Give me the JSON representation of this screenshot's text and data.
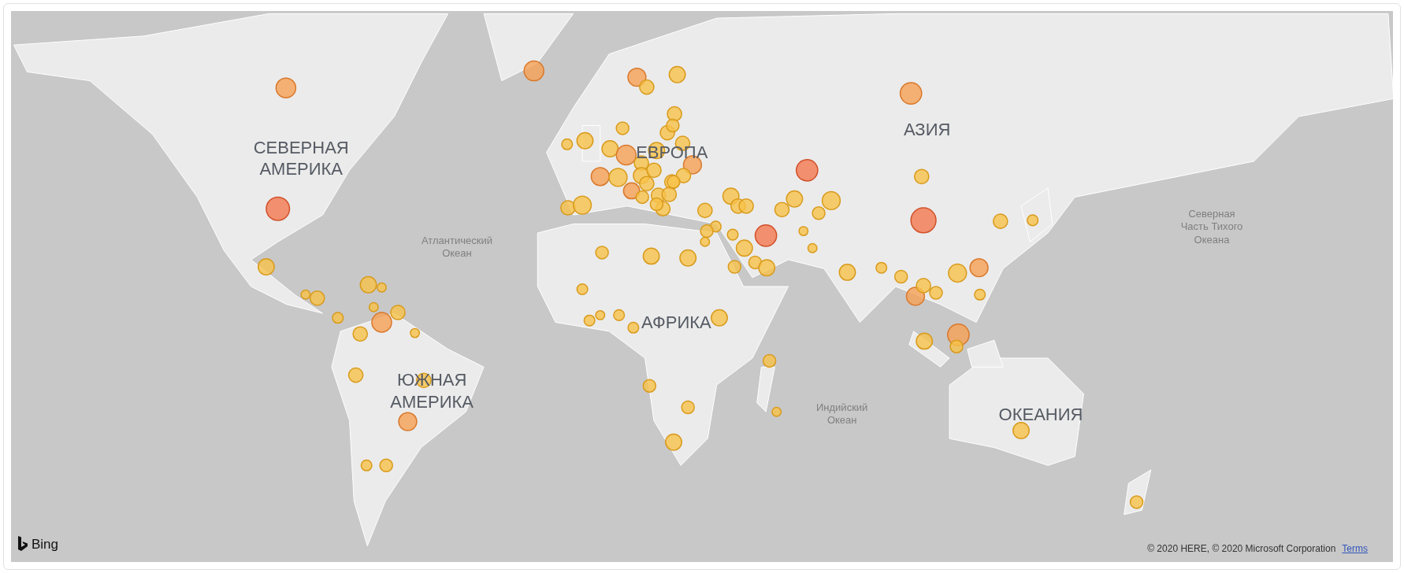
{
  "map": {
    "labels": [
      {
        "kind": "continent",
        "text": "СЕВЕРНАЯ АМЕРИКА"
      },
      {
        "kind": "continent",
        "text": "ЕВРОПА"
      },
      {
        "kind": "continent",
        "text": "АЗИЯ"
      },
      {
        "kind": "ocean",
        "text": "Атлантический Океан"
      },
      {
        "kind": "ocean",
        "text": "Северная Часть Тихого Океана"
      },
      {
        "kind": "continent",
        "text": "АФРИКА"
      },
      {
        "kind": "continent",
        "text": "ЮЖНАЯ АМЕРИКА"
      },
      {
        "kind": "ocean",
        "text": "Индийский Океан"
      },
      {
        "kind": "continent",
        "text": "ОКЕАНИЯ"
      }
    ],
    "logo": "Bing",
    "attribution": "© 2020 HERE, © 2020 Microsoft Corporation",
    "terms_link": "Terms"
  }
}
